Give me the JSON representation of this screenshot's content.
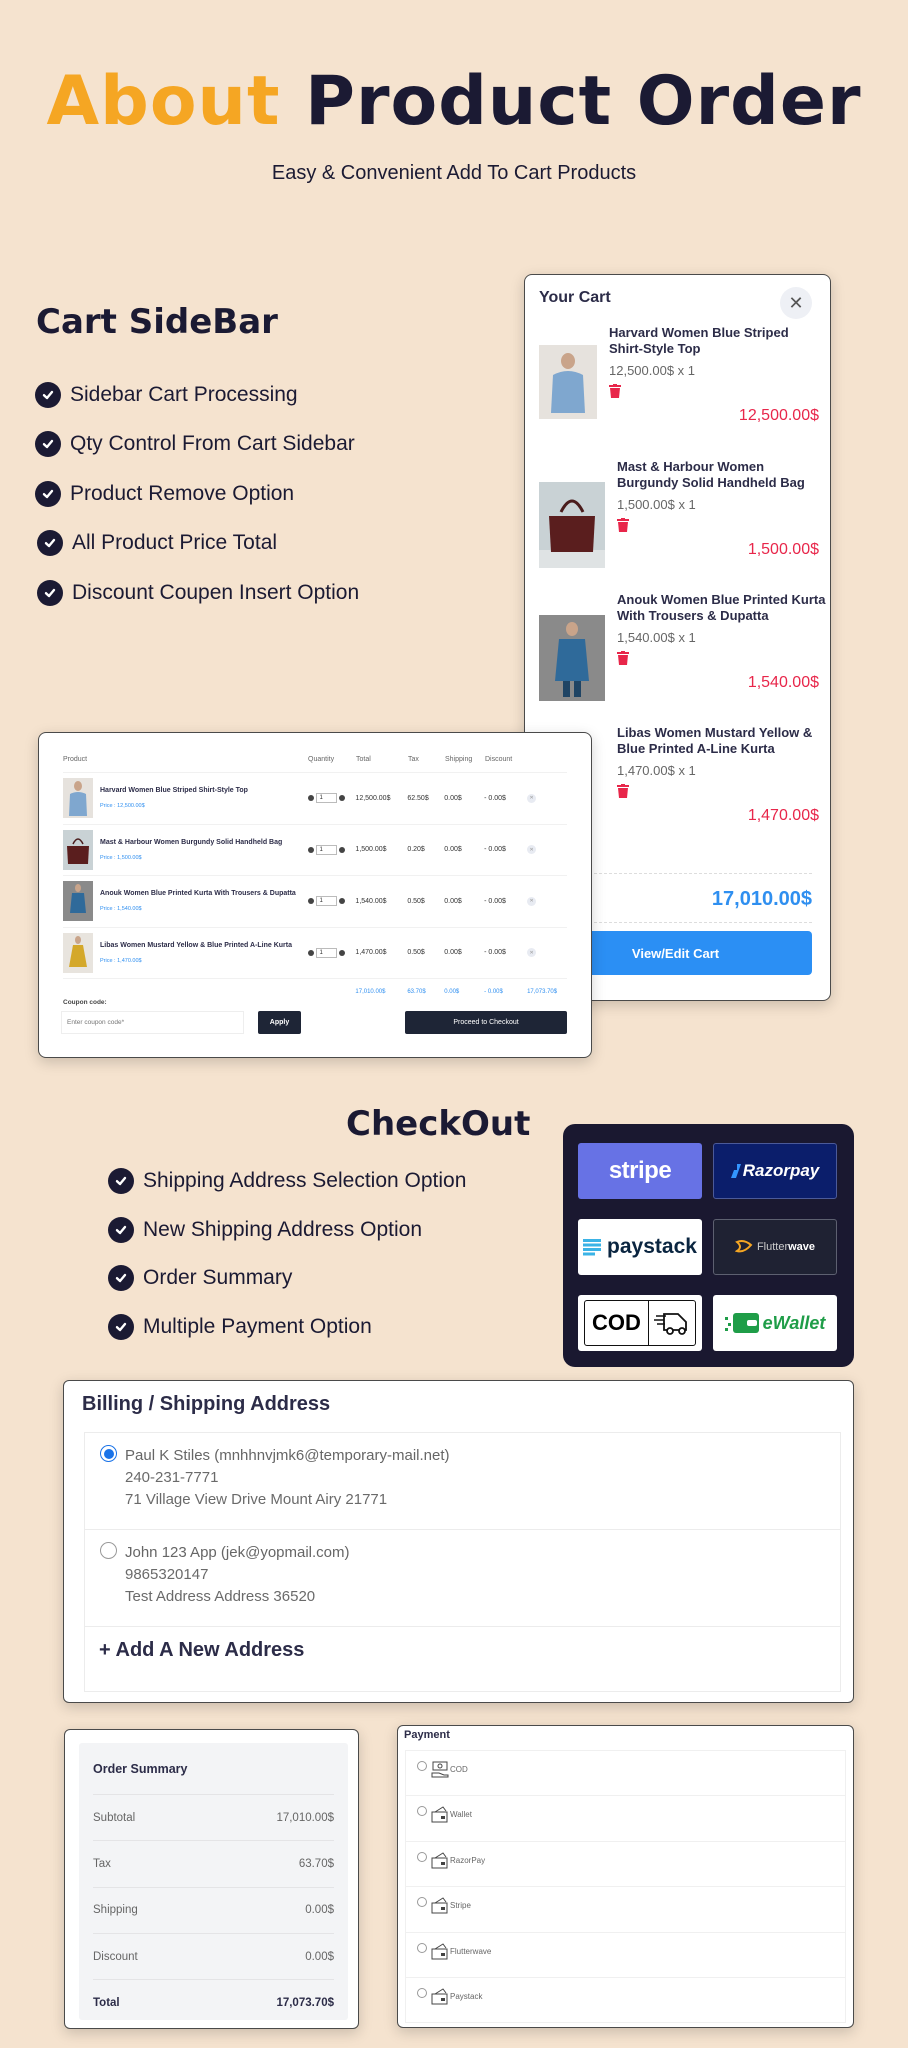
{
  "hero": {
    "title_accent": "About",
    "title_rest": "Product Order",
    "subtitle": "Easy & Convenient Add To Cart Products",
    "accent_color": "#f5a623",
    "dark_color": "#1b1a33"
  },
  "cart_sidebar_section": {
    "title": "Cart SideBar",
    "features": [
      "Sidebar Cart Processing",
      "Qty Control From Cart Sidebar",
      "Product Remove Option",
      "All Product Price Total",
      "Discount Coupen Insert Option"
    ]
  },
  "cart_sidebar": {
    "title": "Your Cart",
    "close_icon": "close-icon",
    "items": [
      {
        "name": "Harvard Women Blue Striped Shirt-Style Top",
        "qty_line": "12,500.00$ x 1",
        "price": "12,500.00$"
      },
      {
        "name": "Mast & Harbour Women Burgundy Solid Handheld Bag",
        "qty_line": "1,500.00$ x 1",
        "price": "1,500.00$"
      },
      {
        "name": "Anouk Women Blue Printed Kurta With Trousers & Dupatta",
        "qty_line": "1,540.00$ x 1",
        "price": "1,540.00$"
      },
      {
        "name": "Libas Women Mustard Yellow & Blue Printed A-Line Kurta",
        "qty_line": "1,470.00$ x 1",
        "price": "1,470.00$"
      }
    ],
    "total": "17,010.00$",
    "view_cart_label": "View/Edit Cart",
    "price_color": "#e8264a",
    "total_color": "#2f8ff0",
    "button_color": "#2b8ff4"
  },
  "cart_table": {
    "headers": [
      "Product",
      "Quantity",
      "Total",
      "Tax",
      "Shipping",
      "Discount"
    ],
    "rows": [
      {
        "name": "Harvard Women Blue Striped Shirt-Style Top",
        "price": "Price : 12,500.00$",
        "qty": "1",
        "total": "12,500.00$",
        "tax": "62.50$",
        "shipping": "0.00$",
        "discount": "- 0.00$"
      },
      {
        "name": "Mast & Harbour Women Burgundy Solid Handheld Bag",
        "price": "Price : 1,500.00$",
        "qty": "1",
        "total": "1,500.00$",
        "tax": "0.20$",
        "shipping": "0.00$",
        "discount": "- 0.00$"
      },
      {
        "name": "Anouk Women Blue Printed Kurta With Trousers & Dupatta",
        "price": "Price : 1,540.00$",
        "qty": "1",
        "total": "1,540.00$",
        "tax": "0.50$",
        "shipping": "0.00$",
        "discount": "- 0.00$"
      },
      {
        "name": "Libas Women Mustard Yellow & Blue Printed A-Line Kurta",
        "price": "Price : 1,470.00$",
        "qty": "1",
        "total": "1,470.00$",
        "tax": "0.50$",
        "shipping": "0.00$",
        "discount": "- 0.00$"
      }
    ],
    "totals": {
      "total": "17,010.00$",
      "tax": "63.70$",
      "shipping": "0.00$",
      "discount": "- 0.00$",
      "grand": "17,073.70$"
    },
    "coupon_label": "Coupon code:",
    "coupon_placeholder": "Enter coupon code*",
    "apply_label": "Apply",
    "checkout_label": "Proceed to Checkout"
  },
  "checkout_section": {
    "title": "CheckOut",
    "features": [
      "Shipping Address Selection Option",
      "New Shipping Address Option",
      "Order Summary",
      "Multiple Payment Option"
    ]
  },
  "payment_logos": [
    {
      "name": "stripe",
      "label": "stripe",
      "bg": "#6772e5"
    },
    {
      "name": "razorpay",
      "label": "Razorpay",
      "bg": "#0b1e6b"
    },
    {
      "name": "paystack",
      "label": "paystack",
      "bg": "#ffffff"
    },
    {
      "name": "flutterwave",
      "label_a": "Flutter",
      "label_b": "wave",
      "bg": "#1f2233"
    },
    {
      "name": "cod",
      "label": "COD",
      "bg": "#ffffff"
    },
    {
      "name": "ewallet",
      "label": "eWallet",
      "bg": "#ffffff"
    }
  ],
  "address": {
    "title": "Billing / Shipping Address",
    "options": [
      {
        "name_email": "Paul K Stiles (mnhhnvjmk6@temporary-mail.net)",
        "phone": "240-231-7771",
        "street": "71 Village View Drive Mount Airy 21771",
        "selected": true
      },
      {
        "name_email": "John 123 App (jek@yopmail.com)",
        "phone": "9865320147",
        "street": "Test Address Address 36520",
        "selected": false
      }
    ],
    "add_label": "+ Add A New Address"
  },
  "order_summary": {
    "title": "Order Summary",
    "rows": [
      {
        "label": "Subtotal",
        "value": "17,010.00$"
      },
      {
        "label": "Tax",
        "value": "63.70$"
      },
      {
        "label": "Shipping",
        "value": "0.00$"
      },
      {
        "label": "Discount",
        "value": "0.00$"
      }
    ],
    "total_label": "Total",
    "total_value": "17,073.70$"
  },
  "payment": {
    "title": "Payment",
    "methods": [
      "COD",
      "Wallet",
      "RazorPay",
      "Stripe",
      "Flutterwave",
      "Paystack"
    ]
  }
}
